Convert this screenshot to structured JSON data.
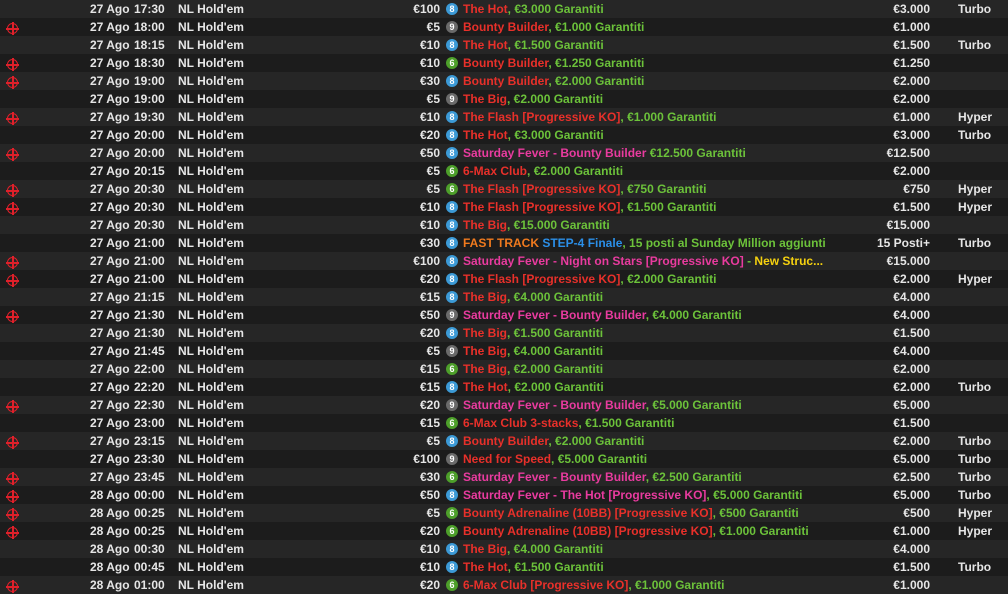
{
  "colors": {
    "name_red": "#e8302a",
    "name_pink": "#e93b9f",
    "guarantee_green": "#6cc23a",
    "badge_8": "#3c9ad6",
    "badge_9": "#6a6a6a",
    "badge_6": "#4d9f2a",
    "fast_track_orange": "#f07a1e",
    "step_blue": "#2b8fe8",
    "new_structure_yellow": "#f5d10f",
    "ko_icon_red": "#e0202a"
  },
  "rows": [
    {
      "ko": false,
      "date": "27 Ago",
      "time": "17:30",
      "game": "NL Hold'em",
      "buyin": "€100",
      "seats": "8",
      "name": [
        {
          "t": "The Hot",
          "c": "red"
        },
        {
          "t": ", ",
          "c": "sep"
        },
        {
          "t": "€3.000 Garantiti",
          "c": "gt"
        }
      ],
      "prize": "€3.000",
      "speed": "Turbo"
    },
    {
      "ko": true,
      "date": "27 Ago",
      "time": "18:00",
      "game": "NL Hold'em",
      "buyin": "€5",
      "seats": "9",
      "name": [
        {
          "t": "Bounty Builder",
          "c": "red"
        },
        {
          "t": ", ",
          "c": "sep"
        },
        {
          "t": "€1.000 Garantiti",
          "c": "gt"
        }
      ],
      "prize": "€1.000",
      "speed": ""
    },
    {
      "ko": false,
      "date": "27 Ago",
      "time": "18:15",
      "game": "NL Hold'em",
      "buyin": "€10",
      "seats": "8",
      "name": [
        {
          "t": "The Hot",
          "c": "red"
        },
        {
          "t": ", ",
          "c": "sep"
        },
        {
          "t": "€1.500 Garantiti",
          "c": "gt"
        }
      ],
      "prize": "€1.500",
      "speed": "Turbo"
    },
    {
      "ko": true,
      "date": "27 Ago",
      "time": "18:30",
      "game": "NL Hold'em",
      "buyin": "€10",
      "seats": "6",
      "name": [
        {
          "t": "Bounty Builder",
          "c": "red"
        },
        {
          "t": ", ",
          "c": "sep"
        },
        {
          "t": "€1.250 Garantiti",
          "c": "gt"
        }
      ],
      "prize": "€1.250",
      "speed": ""
    },
    {
      "ko": true,
      "date": "27 Ago",
      "time": "19:00",
      "game": "NL Hold'em",
      "buyin": "€30",
      "seats": "8",
      "name": [
        {
          "t": "Bounty Builder",
          "c": "red"
        },
        {
          "t": ", ",
          "c": "sep"
        },
        {
          "t": "€2.000 Garantiti",
          "c": "gt"
        }
      ],
      "prize": "€2.000",
      "speed": ""
    },
    {
      "ko": false,
      "date": "27 Ago",
      "time": "19:00",
      "game": "NL Hold'em",
      "buyin": "€5",
      "seats": "9",
      "name": [
        {
          "t": "The Big",
          "c": "red"
        },
        {
          "t": ", ",
          "c": "sep"
        },
        {
          "t": "€2.000 Garantiti",
          "c": "gt"
        }
      ],
      "prize": "€2.000",
      "speed": ""
    },
    {
      "ko": true,
      "date": "27 Ago",
      "time": "19:30",
      "game": "NL Hold'em",
      "buyin": "€10",
      "seats": "8",
      "name": [
        {
          "t": "The Flash [Progressive KO]",
          "c": "red"
        },
        {
          "t": ", ",
          "c": "sep"
        },
        {
          "t": "€1.000 Garantiti",
          "c": "gt"
        }
      ],
      "prize": "€1.000",
      "speed": "Hyper"
    },
    {
      "ko": false,
      "date": "27 Ago",
      "time": "20:00",
      "game": "NL Hold'em",
      "buyin": "€20",
      "seats": "8",
      "name": [
        {
          "t": "The Hot",
          "c": "red"
        },
        {
          "t": ", ",
          "c": "sep"
        },
        {
          "t": "€3.000 Garantiti",
          "c": "gt"
        }
      ],
      "prize": "€3.000",
      "speed": "Turbo"
    },
    {
      "ko": true,
      "date": "27 Ago",
      "time": "20:00",
      "game": "NL Hold'em",
      "buyin": "€50",
      "seats": "8",
      "name": [
        {
          "t": "Saturday Fever - Bounty Builder",
          "c": "pink"
        },
        {
          "t": " ",
          "c": "sep"
        },
        {
          "t": "€12.500 Garantiti",
          "c": "gt"
        }
      ],
      "prize": "€12.500",
      "speed": ""
    },
    {
      "ko": false,
      "date": "27 Ago",
      "time": "20:15",
      "game": "NL Hold'em",
      "buyin": "€5",
      "seats": "6",
      "name": [
        {
          "t": "6-Max Club",
          "c": "red"
        },
        {
          "t": ", ",
          "c": "sep"
        },
        {
          "t": "€2.000 Garantiti",
          "c": "gt"
        }
      ],
      "prize": "€2.000",
      "speed": ""
    },
    {
      "ko": true,
      "date": "27 Ago",
      "time": "20:30",
      "game": "NL Hold'em",
      "buyin": "€5",
      "seats": "6",
      "name": [
        {
          "t": "The Flash [Progressive KO]",
          "c": "red"
        },
        {
          "t": ", ",
          "c": "sep"
        },
        {
          "t": "€750 Garantiti",
          "c": "gt"
        }
      ],
      "prize": "€750",
      "speed": "Hyper"
    },
    {
      "ko": true,
      "date": "27 Ago",
      "time": "20:30",
      "game": "NL Hold'em",
      "buyin": "€10",
      "seats": "8",
      "name": [
        {
          "t": "The Flash [Progressive KO]",
          "c": "red"
        },
        {
          "t": ", ",
          "c": "sep"
        },
        {
          "t": "€1.500 Garantiti",
          "c": "gt"
        }
      ],
      "prize": "€1.500",
      "speed": "Hyper"
    },
    {
      "ko": false,
      "date": "27 Ago",
      "time": "20:30",
      "game": "NL Hold'em",
      "buyin": "€10",
      "seats": "8",
      "name": [
        {
          "t": "The Big",
          "c": "red"
        },
        {
          "t": ", ",
          "c": "sep"
        },
        {
          "t": "€15.000 Garantiti",
          "c": "gt"
        }
      ],
      "prize": "€15.000",
      "speed": ""
    },
    {
      "ko": false,
      "date": "27 Ago",
      "time": "21:00",
      "game": "NL Hold'em",
      "buyin": "€30",
      "seats": "8",
      "name": [
        {
          "t": "FAST TRACK",
          "c": "orange"
        },
        {
          "t": " ",
          "c": "sep"
        },
        {
          "t": "STEP-4 Finale",
          "c": "blue"
        },
        {
          "t": ", 15 posti al Sunday Million aggiunti",
          "c": "gt"
        }
      ],
      "prize": "15 Posti+",
      "speed": "Turbo"
    },
    {
      "ko": true,
      "date": "27 Ago",
      "time": "21:00",
      "game": "NL Hold'em",
      "buyin": "€100",
      "seats": "8",
      "name": [
        {
          "t": "Saturday Fever - Night on Stars [Progressive KO]",
          "c": "pink"
        },
        {
          "t": " - ",
          "c": "sep"
        },
        {
          "t": "New Struc...",
          "c": "yellow"
        }
      ],
      "prize": "€15.000",
      "speed": ""
    },
    {
      "ko": true,
      "date": "27 Ago",
      "time": "21:00",
      "game": "NL Hold'em",
      "buyin": "€20",
      "seats": "8",
      "name": [
        {
          "t": "The Flash [Progressive KO]",
          "c": "red"
        },
        {
          "t": ", ",
          "c": "sep"
        },
        {
          "t": "€2.000 Garantiti",
          "c": "gt"
        }
      ],
      "prize": "€2.000",
      "speed": "Hyper"
    },
    {
      "ko": false,
      "date": "27 Ago",
      "time": "21:15",
      "game": "NL Hold'em",
      "buyin": "€15",
      "seats": "8",
      "name": [
        {
          "t": "The Big",
          "c": "red"
        },
        {
          "t": ", ",
          "c": "sep"
        },
        {
          "t": "€4.000 Garantiti",
          "c": "gt"
        }
      ],
      "prize": "€4.000",
      "speed": ""
    },
    {
      "ko": true,
      "date": "27 Ago",
      "time": "21:30",
      "game": "NL Hold'em",
      "buyin": "€50",
      "seats": "9",
      "name": [
        {
          "t": "Saturday Fever - Bounty Builder",
          "c": "pink"
        },
        {
          "t": ", ",
          "c": "sep"
        },
        {
          "t": "€4.000 Garantiti",
          "c": "gt"
        }
      ],
      "prize": "€4.000",
      "speed": ""
    },
    {
      "ko": false,
      "date": "27 Ago",
      "time": "21:30",
      "game": "NL Hold'em",
      "buyin": "€20",
      "seats": "8",
      "name": [
        {
          "t": "The Big",
          "c": "red"
        },
        {
          "t": ", ",
          "c": "sep"
        },
        {
          "t": "€1.500 Garantiti",
          "c": "gt"
        }
      ],
      "prize": "€1.500",
      "speed": ""
    },
    {
      "ko": false,
      "date": "27 Ago",
      "time": "21:45",
      "game": "NL Hold'em",
      "buyin": "€5",
      "seats": "9",
      "name": [
        {
          "t": "The Big",
          "c": "red"
        },
        {
          "t": ", ",
          "c": "sep"
        },
        {
          "t": "€4.000 Garantiti",
          "c": "gt"
        }
      ],
      "prize": "€4.000",
      "speed": ""
    },
    {
      "ko": false,
      "date": "27 Ago",
      "time": "22:00",
      "game": "NL Hold'em",
      "buyin": "€15",
      "seats": "6",
      "name": [
        {
          "t": "The Big",
          "c": "red"
        },
        {
          "t": ", ",
          "c": "sep"
        },
        {
          "t": "€2.000 Garantiti",
          "c": "gt"
        }
      ],
      "prize": "€2.000",
      "speed": ""
    },
    {
      "ko": false,
      "date": "27 Ago",
      "time": "22:20",
      "game": "NL Hold'em",
      "buyin": "€15",
      "seats": "8",
      "name": [
        {
          "t": "The Hot",
          "c": "red"
        },
        {
          "t": ", ",
          "c": "sep"
        },
        {
          "t": "€2.000 Garantiti",
          "c": "gt"
        }
      ],
      "prize": "€2.000",
      "speed": "Turbo"
    },
    {
      "ko": true,
      "date": "27 Ago",
      "time": "22:30",
      "game": "NL Hold'em",
      "buyin": "€20",
      "seats": "9",
      "name": [
        {
          "t": "Saturday Fever - Bounty Builder",
          "c": "pink"
        },
        {
          "t": ", ",
          "c": "sep"
        },
        {
          "t": "€5.000 Garantiti",
          "c": "gt"
        }
      ],
      "prize": "€5.000",
      "speed": ""
    },
    {
      "ko": false,
      "date": "27 Ago",
      "time": "23:00",
      "game": "NL Hold'em",
      "buyin": "€15",
      "seats": "6",
      "name": [
        {
          "t": "6-Max Club 3-stacks",
          "c": "red"
        },
        {
          "t": ", ",
          "c": "sep"
        },
        {
          "t": "€1.500 Garantiti",
          "c": "gt"
        }
      ],
      "prize": "€1.500",
      "speed": ""
    },
    {
      "ko": true,
      "date": "27 Ago",
      "time": "23:15",
      "game": "NL Hold'em",
      "buyin": "€5",
      "seats": "8",
      "name": [
        {
          "t": "Bounty Builder",
          "c": "red"
        },
        {
          "t": ", ",
          "c": "sep"
        },
        {
          "t": "€2.000 Garantiti",
          "c": "gt"
        }
      ],
      "prize": "€2.000",
      "speed": "Turbo"
    },
    {
      "ko": false,
      "date": "27 Ago",
      "time": "23:30",
      "game": "NL Hold'em",
      "buyin": "€100",
      "seats": "9",
      "name": [
        {
          "t": "Need for Speed",
          "c": "red"
        },
        {
          "t": ", ",
          "c": "sep"
        },
        {
          "t": "€5.000 Garantiti",
          "c": "gt"
        }
      ],
      "prize": "€5.000",
      "speed": "Turbo"
    },
    {
      "ko": true,
      "date": "27 Ago",
      "time": "23:45",
      "game": "NL Hold'em",
      "buyin": "€30",
      "seats": "6",
      "name": [
        {
          "t": "Saturday Fever - Bounty Builder",
          "c": "pink"
        },
        {
          "t": ", ",
          "c": "sep"
        },
        {
          "t": "€2.500 Garantiti",
          "c": "gt"
        }
      ],
      "prize": "€2.500",
      "speed": "Turbo"
    },
    {
      "ko": true,
      "date": "28 Ago",
      "time": "00:00",
      "game": "NL Hold'em",
      "buyin": "€50",
      "seats": "8",
      "name": [
        {
          "t": "Saturday Fever - The Hot [Progressive KO]",
          "c": "pink"
        },
        {
          "t": ", ",
          "c": "sep"
        },
        {
          "t": "€5.000 Garantiti",
          "c": "gt"
        }
      ],
      "prize": "€5.000",
      "speed": "Turbo"
    },
    {
      "ko": true,
      "date": "28 Ago",
      "time": "00:25",
      "game": "NL Hold'em",
      "buyin": "€5",
      "seats": "6",
      "name": [
        {
          "t": "Bounty Adrenaline (10BB) [Progressive KO]",
          "c": "red"
        },
        {
          "t": ", ",
          "c": "sep"
        },
        {
          "t": "€500 Garantiti",
          "c": "gt"
        }
      ],
      "prize": "€500",
      "speed": "Hyper"
    },
    {
      "ko": true,
      "date": "28 Ago",
      "time": "00:25",
      "game": "NL Hold'em",
      "buyin": "€20",
      "seats": "6",
      "name": [
        {
          "t": "Bounty Adrenaline (10BB) [Progressive KO]",
          "c": "red"
        },
        {
          "t": ", ",
          "c": "sep"
        },
        {
          "t": "€1.000 Garantiti",
          "c": "gt"
        }
      ],
      "prize": "€1.000",
      "speed": "Hyper"
    },
    {
      "ko": false,
      "date": "28 Ago",
      "time": "00:30",
      "game": "NL Hold'em",
      "buyin": "€10",
      "seats": "8",
      "name": [
        {
          "t": "The Big",
          "c": "red"
        },
        {
          "t": ", ",
          "c": "sep"
        },
        {
          "t": "€4.000 Garantiti",
          "c": "gt"
        }
      ],
      "prize": "€4.000",
      "speed": ""
    },
    {
      "ko": false,
      "date": "28 Ago",
      "time": "00:45",
      "game": "NL Hold'em",
      "buyin": "€10",
      "seats": "8",
      "name": [
        {
          "t": "The Hot",
          "c": "red"
        },
        {
          "t": ", ",
          "c": "sep"
        },
        {
          "t": "€1.500 Garantiti",
          "c": "gt"
        }
      ],
      "prize": "€1.500",
      "speed": "Turbo"
    },
    {
      "ko": true,
      "date": "28 Ago",
      "time": "01:00",
      "game": "NL Hold'em",
      "buyin": "€20",
      "seats": "6",
      "name": [
        {
          "t": "6-Max Club [Progressive KO]",
          "c": "red"
        },
        {
          "t": ", ",
          "c": "sep"
        },
        {
          "t": "€1.000 Garantiti",
          "c": "gt"
        }
      ],
      "prize": "€1.000",
      "speed": ""
    }
  ]
}
